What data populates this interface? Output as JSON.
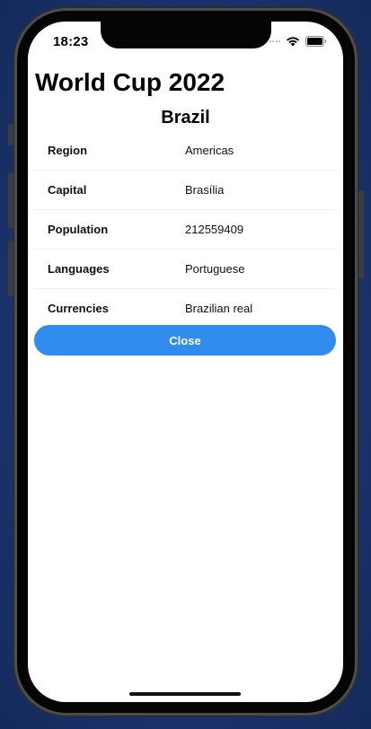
{
  "status_bar": {
    "time": "18:23",
    "icons": [
      "cellular-signal-icon",
      "wifi-icon",
      "battery-icon"
    ]
  },
  "app": {
    "title": "World Cup 2022"
  },
  "detail": {
    "country": "Brazil",
    "rows": [
      {
        "label": "Region",
        "value": "Americas"
      },
      {
        "label": "Capital",
        "value": "Brasília"
      },
      {
        "label": "Population",
        "value": "212559409"
      },
      {
        "label": "Languages",
        "value": "Portuguese"
      },
      {
        "label": "Currencies",
        "value": "Brazilian real"
      }
    ],
    "close_label": "Close"
  },
  "colors": {
    "accent": "#2f8cec",
    "background": "#ffffff",
    "device_backdrop": "#1d3570"
  }
}
